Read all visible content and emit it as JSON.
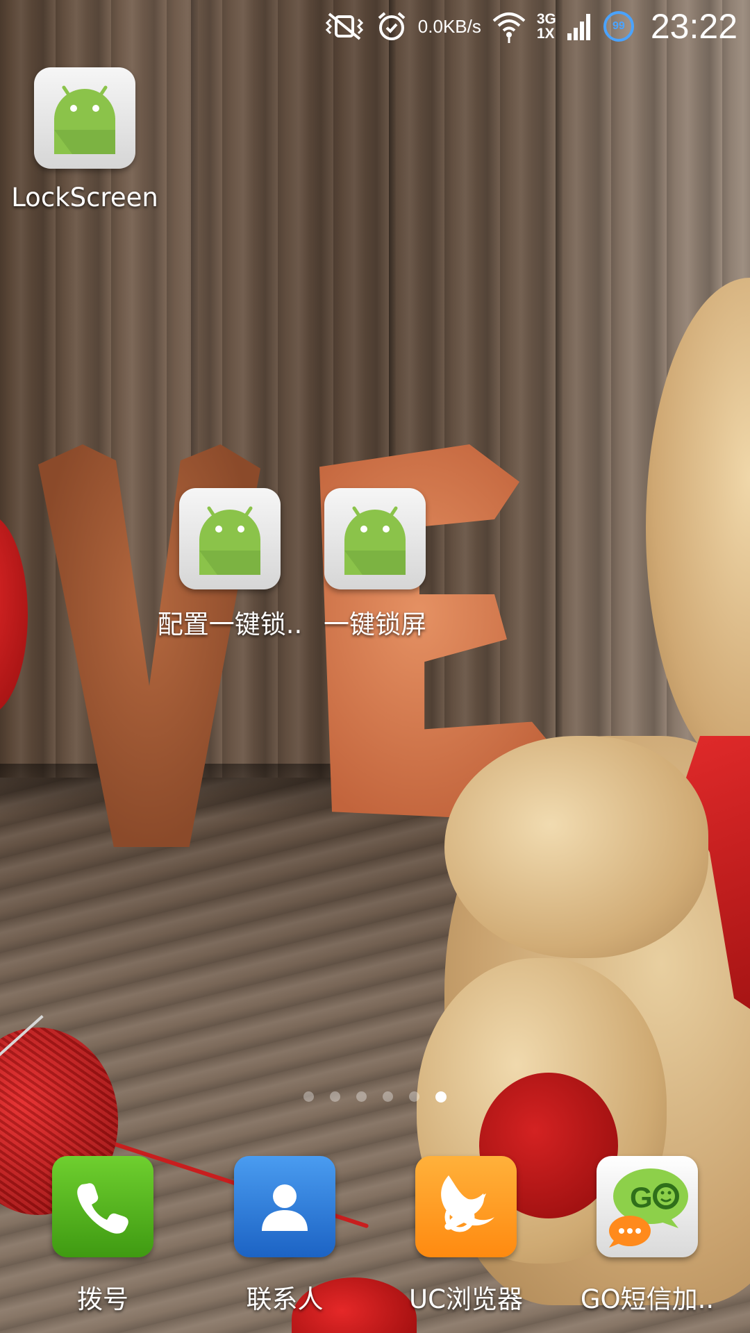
{
  "status_bar": {
    "net_speed": "0.0KB/s",
    "network_top": "3G",
    "network_bottom": "1X",
    "battery_badge": "99",
    "time": "23:22"
  },
  "desktop_apps": [
    {
      "label": "LockScreen",
      "icon": "android-icon"
    },
    {
      "label": "配置一键锁..",
      "icon": "android-icon"
    },
    {
      "label": "一键锁屏",
      "icon": "android-icon"
    }
  ],
  "page_indicator": {
    "count": 6,
    "active_index": 5
  },
  "dock": [
    {
      "label": "拨号",
      "icon": "phone-icon",
      "color": "#4caf1a"
    },
    {
      "label": "联系人",
      "icon": "contact-icon",
      "color": "#2f7fe0"
    },
    {
      "label": "UC浏览器",
      "icon": "uc-squirrel-icon",
      "color": "#ff9a1f"
    },
    {
      "label": "GO短信加..",
      "icon": "go-sms-icon",
      "color": "#7cc242"
    }
  ],
  "colors": {
    "android_green": "#8bc34a",
    "status_blue": "#4aa3ff"
  }
}
